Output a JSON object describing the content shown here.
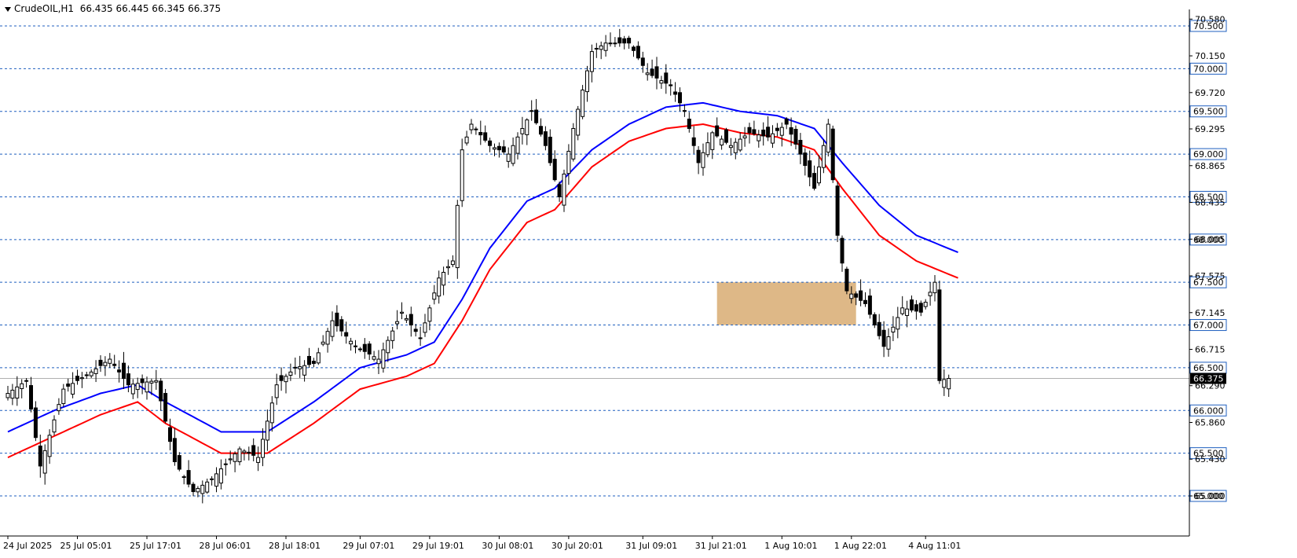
{
  "header": {
    "symbol": "CrudeOIL,H1",
    "ohlc": "66.435 66.445 66.345 66.375"
  },
  "colors": {
    "background": "#ffffff",
    "bull_candle": "#ffffff",
    "bear_candle": "#000000",
    "ma_fast": "#0000ff",
    "ma_slow": "#ff0000",
    "level_line": "#1f5fbf",
    "zone_fill": "#deb887",
    "current_price": "#000000"
  },
  "chart_data": {
    "type": "candlestick",
    "symbol": "CrudeOIL",
    "timeframe": "H1",
    "ylim": [
      64.9,
      70.65
    ],
    "current_price": 66.375,
    "price_ticks": [
      "70.580",
      "70.150",
      "69.720",
      "69.295",
      "68.865",
      "68.435",
      "68.005",
      "67.575",
      "67.145",
      "66.715",
      "66.290",
      "65.860",
      "65.430",
      "65.000"
    ],
    "level_lines": [
      "70.500",
      "70.000",
      "69.500",
      "69.000",
      "68.500",
      "68.000",
      "67.500",
      "67.000",
      "66.500",
      "66.000",
      "65.500",
      "65.000"
    ],
    "time_labels": [
      "24 Jul 2025",
      "25 Jul 05:01",
      "25 Jul 17:01",
      "28 Jul 06:01",
      "28 Jul 18:01",
      "29 Jul 07:01",
      "29 Jul 19:01",
      "30 Jul 08:01",
      "30 Jul 20:01",
      "31 Jul 09:01",
      "31 Jul 21:01",
      "1 Aug 10:01",
      "1 Aug 22:01",
      "4 Aug 11:01"
    ],
    "zone": {
      "low": 67.0,
      "high": 67.5,
      "start_index": 153,
      "end_index": 183
    },
    "anchor_closes": [
      {
        "i": 0,
        "c": 66.2
      },
      {
        "i": 4,
        "c": 66.35
      },
      {
        "i": 7,
        "c": 65.35
      },
      {
        "i": 12,
        "c": 66.25
      },
      {
        "i": 18,
        "c": 66.45
      },
      {
        "i": 22,
        "c": 66.6
      },
      {
        "i": 26,
        "c": 66.3
      },
      {
        "i": 32,
        "c": 66.35
      },
      {
        "i": 36,
        "c": 65.4
      },
      {
        "i": 40,
        "c": 65.05
      },
      {
        "i": 44,
        "c": 65.2
      },
      {
        "i": 50,
        "c": 65.55
      },
      {
        "i": 54,
        "c": 65.45
      },
      {
        "i": 58,
        "c": 66.3
      },
      {
        "i": 62,
        "c": 66.5
      },
      {
        "i": 66,
        "c": 66.55
      },
      {
        "i": 70,
        "c": 67.05
      },
      {
        "i": 75,
        "c": 66.75
      },
      {
        "i": 80,
        "c": 66.6
      },
      {
        "i": 85,
        "c": 67.15
      },
      {
        "i": 89,
        "c": 66.85
      },
      {
        "i": 93,
        "c": 67.55
      },
      {
        "i": 96,
        "c": 67.75
      },
      {
        "i": 98,
        "c": 69.05
      },
      {
        "i": 100,
        "c": 69.35
      },
      {
        "i": 104,
        "c": 69.1
      },
      {
        "i": 108,
        "c": 69.0
      },
      {
        "i": 113,
        "c": 69.5
      },
      {
        "i": 116,
        "c": 69.1
      },
      {
        "i": 119,
        "c": 68.5
      },
      {
        "i": 122,
        "c": 69.3
      },
      {
        "i": 126,
        "c": 70.2
      },
      {
        "i": 129,
        "c": 70.3
      },
      {
        "i": 134,
        "c": 70.3
      },
      {
        "i": 138,
        "c": 69.95
      },
      {
        "i": 143,
        "c": 69.8
      },
      {
        "i": 146,
        "c": 69.5
      },
      {
        "i": 149,
        "c": 68.9
      },
      {
        "i": 152,
        "c": 69.25
      },
      {
        "i": 156,
        "c": 69.1
      },
      {
        "i": 160,
        "c": 69.25
      },
      {
        "i": 164,
        "c": 69.2
      },
      {
        "i": 168,
        "c": 69.35
      },
      {
        "i": 171,
        "c": 69.0
      },
      {
        "i": 174,
        "c": 68.6
      },
      {
        "i": 177,
        "c": 69.35
      },
      {
        "i": 179,
        "c": 68.05
      },
      {
        "i": 181,
        "c": 67.4
      },
      {
        "i": 185,
        "c": 67.25
      },
      {
        "i": 189,
        "c": 66.75
      },
      {
        "i": 193,
        "c": 67.2
      },
      {
        "i": 197,
        "c": 67.15
      },
      {
        "i": 200,
        "c": 67.5
      },
      {
        "i": 201,
        "c": 66.35
      },
      {
        "i": 203,
        "c": 66.375
      }
    ],
    "ma_fast": [
      {
        "i": 0,
        "v": 65.75
      },
      {
        "i": 10,
        "v": 66.0
      },
      {
        "i": 20,
        "v": 66.2
      },
      {
        "i": 28,
        "v": 66.3
      },
      {
        "i": 34,
        "v": 66.1
      },
      {
        "i": 46,
        "v": 65.75
      },
      {
        "i": 56,
        "v": 65.75
      },
      {
        "i": 66,
        "v": 66.1
      },
      {
        "i": 76,
        "v": 66.5
      },
      {
        "i": 86,
        "v": 66.65
      },
      {
        "i": 92,
        "v": 66.8
      },
      {
        "i": 98,
        "v": 67.3
      },
      {
        "i": 104,
        "v": 67.9
      },
      {
        "i": 112,
        "v": 68.45
      },
      {
        "i": 118,
        "v": 68.6
      },
      {
        "i": 126,
        "v": 69.05
      },
      {
        "i": 134,
        "v": 69.35
      },
      {
        "i": 142,
        "v": 69.55
      },
      {
        "i": 150,
        "v": 69.6
      },
      {
        "i": 158,
        "v": 69.5
      },
      {
        "i": 166,
        "v": 69.45
      },
      {
        "i": 174,
        "v": 69.3
      },
      {
        "i": 180,
        "v": 68.9
      },
      {
        "i": 188,
        "v": 68.4
      },
      {
        "i": 196,
        "v": 68.05
      },
      {
        "i": 205,
        "v": 67.85
      }
    ],
    "ma_slow": [
      {
        "i": 0,
        "v": 65.45
      },
      {
        "i": 10,
        "v": 65.7
      },
      {
        "i": 20,
        "v": 65.95
      },
      {
        "i": 28,
        "v": 66.1
      },
      {
        "i": 34,
        "v": 65.85
      },
      {
        "i": 46,
        "v": 65.5
      },
      {
        "i": 56,
        "v": 65.5
      },
      {
        "i": 66,
        "v": 65.85
      },
      {
        "i": 76,
        "v": 66.25
      },
      {
        "i": 86,
        "v": 66.4
      },
      {
        "i": 92,
        "v": 66.55
      },
      {
        "i": 98,
        "v": 67.05
      },
      {
        "i": 104,
        "v": 67.65
      },
      {
        "i": 112,
        "v": 68.2
      },
      {
        "i": 118,
        "v": 68.35
      },
      {
        "i": 126,
        "v": 68.85
      },
      {
        "i": 134,
        "v": 69.15
      },
      {
        "i": 142,
        "v": 69.3
      },
      {
        "i": 150,
        "v": 69.35
      },
      {
        "i": 158,
        "v": 69.25
      },
      {
        "i": 166,
        "v": 69.2
      },
      {
        "i": 174,
        "v": 69.05
      },
      {
        "i": 180,
        "v": 68.6
      },
      {
        "i": 188,
        "v": 68.05
      },
      {
        "i": 196,
        "v": 67.75
      },
      {
        "i": 205,
        "v": 67.55
      }
    ],
    "grid": false,
    "legend": "none"
  }
}
